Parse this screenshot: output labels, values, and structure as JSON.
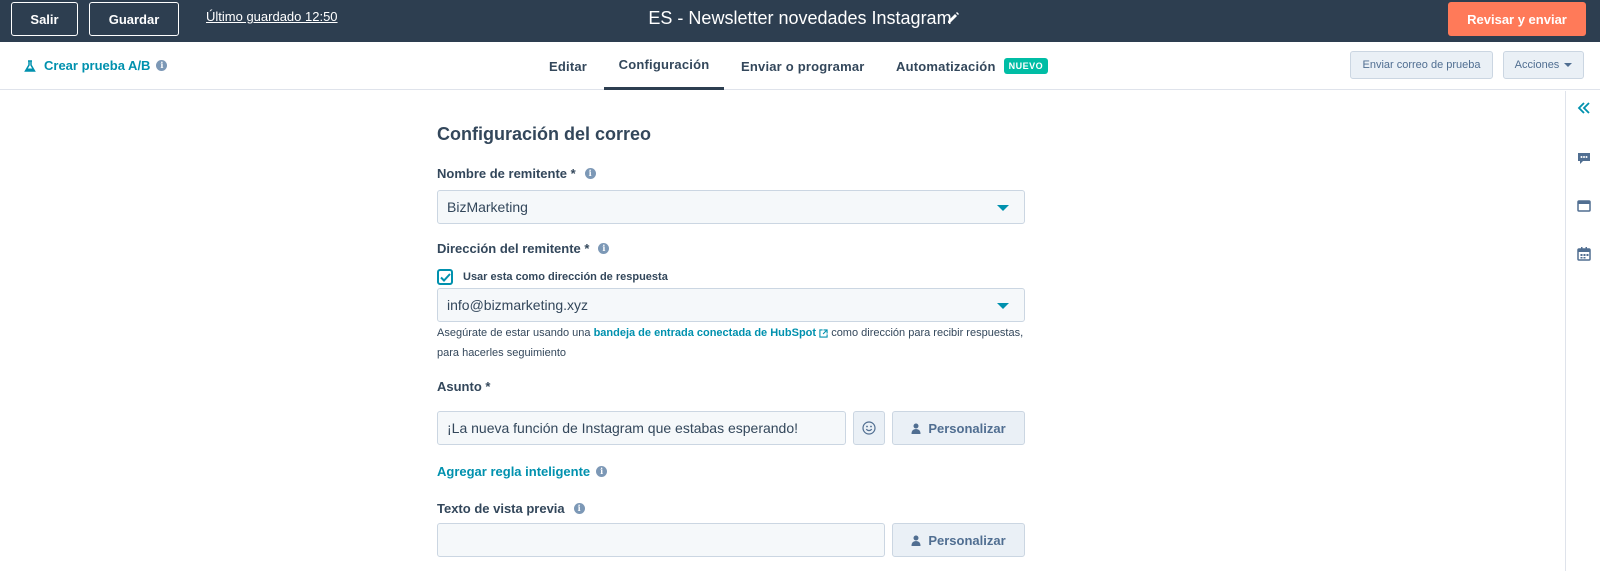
{
  "topbar": {
    "exit_label": "Salir",
    "save_label": "Guardar",
    "last_saved": "Último guardado 12:50",
    "title": "ES - Newsletter novedades Instagram",
    "review_label": "Revisar y enviar",
    "background_color": "#2d3e50",
    "primary_color": "#ff7a59"
  },
  "subnav": {
    "ab_test_label": "Crear prueba A/B",
    "tabs": [
      {
        "label": "Editar"
      },
      {
        "label": "Configuración",
        "active": true
      },
      {
        "label": "Enviar o programar"
      },
      {
        "label": "Automatización",
        "badge": "NUEVO"
      }
    ],
    "send_test_label": "Enviar correo de prueba",
    "actions_label": "Acciones"
  },
  "form": {
    "section_title": "Configuración del correo",
    "sender_name": {
      "label": "Nombre de remitente *",
      "value": "BizMarketing"
    },
    "sender_address": {
      "label": "Dirección del remitente *",
      "reply_checkbox_label": "Usar esta como dirección de respuesta",
      "reply_checked": true,
      "value": "info@bizmarketing.xyz",
      "help_prefix": "Asegúrate de estar usando una ",
      "help_link": "bandeja de entrada conectada de HubSpot",
      "help_suffix_line1": " como dirección para recibir respuestas,",
      "help_suffix_line2": "para hacerles seguimiento"
    },
    "subject": {
      "label": "Asunto *",
      "value": "¡La nueva función de Instagram que estabas esperando!",
      "personalize_label": "Personalizar"
    },
    "smart_rule_label": "Agregar regla inteligente",
    "preview_text": {
      "label": "Texto de vista previa",
      "value": "",
      "personalize_label": "Personalizar"
    }
  },
  "rail_icons": [
    "collapse-icon",
    "comment-icon",
    "preview-icon",
    "calendar-icon"
  ],
  "accent_color": "#0091ae"
}
